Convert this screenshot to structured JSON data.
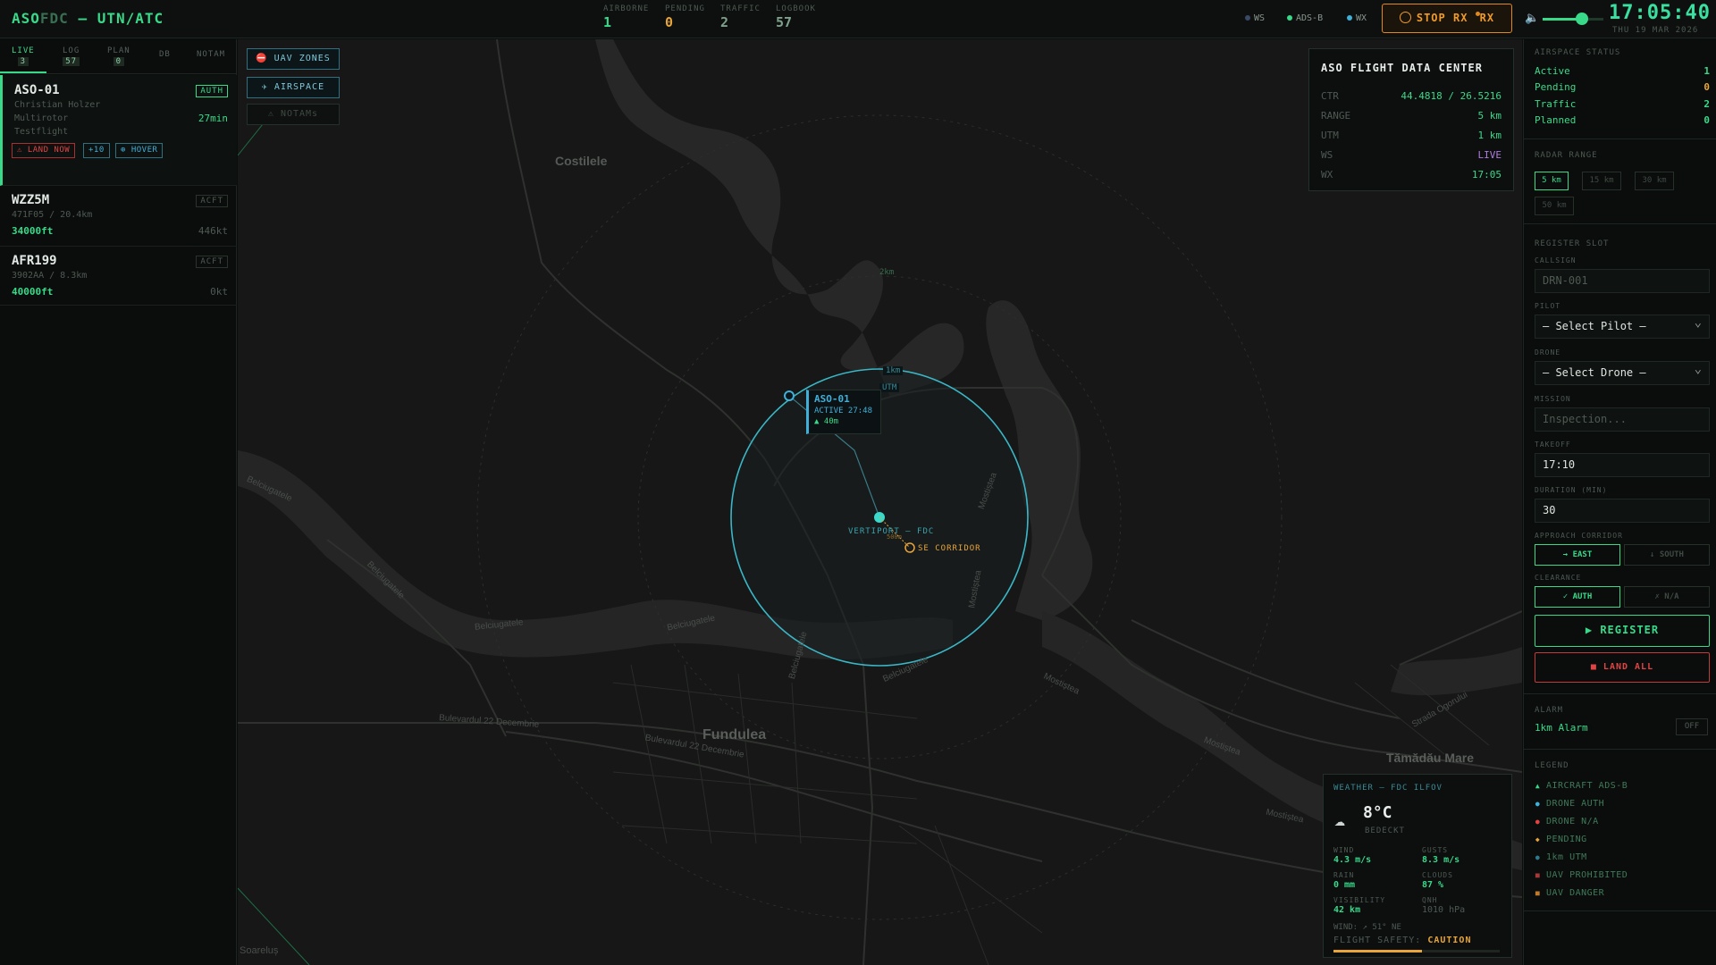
{
  "brand": {
    "aso": "ASO",
    "fdc": "FDC",
    "rest": " — UTN/ATC"
  },
  "stats": [
    {
      "label": "AIRBORNE",
      "value": "1",
      "color": "#39d98a"
    },
    {
      "label": "PENDING",
      "value": "0",
      "color": "#e8a53a"
    },
    {
      "label": "TRAFFIC",
      "value": "2",
      "color": "#7fa08c"
    },
    {
      "label": "LOGBOOK",
      "value": "57",
      "color": "#7fa08c"
    }
  ],
  "indicators": [
    {
      "label": "WS",
      "color": "#3a4a66"
    },
    {
      "label": "ADS-B",
      "color": "#39d98a"
    },
    {
      "label": "WX",
      "color": "#3fb0d9"
    }
  ],
  "stop_rx": {
    "label": "STOP RX",
    "suffix": "RX"
  },
  "clock": {
    "time": "17:05:40",
    "date": "THU 19 MAR 2026"
  },
  "volume": 0.65,
  "left_tabs": [
    {
      "label": "LIVE",
      "count": "3",
      "active": true
    },
    {
      "label": "LOG",
      "count": "57"
    },
    {
      "label": "PLAN",
      "count": "0"
    },
    {
      "label": "DB",
      "count": ""
    },
    {
      "label": "NOTAM",
      "count": ""
    }
  ],
  "flights": [
    {
      "callsign": "ASO-01",
      "badge": "AUTH",
      "pilot": "Christian Holzer",
      "type": "Multirotor",
      "mission": "Testflight",
      "time": "27min",
      "chips": [
        "⚠ LAND NOW",
        "+10",
        "⊕ HOVER"
      ]
    },
    {
      "callsign": "WZZ5M",
      "badge": "ACFT",
      "sub": "471F05 / 20.4km",
      "alt": "34000ft",
      "speed": "446kt"
    },
    {
      "callsign": "AFR199",
      "badge": "ACFT",
      "sub": "3902AA / 8.3km",
      "alt": "40000ft",
      "speed": "0kt"
    }
  ],
  "map": {
    "buttons": [
      "⛔ UAV ZONES",
      "✈ AIRSPACE",
      "⚠ NOTAMs"
    ],
    "places": [
      "Costilele",
      "Fundulea",
      "Tămădău Mare",
      "Soareluș"
    ],
    "streets": [
      "Belciugatele",
      "Belciugatele",
      "Belciugatele",
      "Belciugatele",
      "Belciugatele",
      "Bulevardul 22 Decembrie",
      "Bulevardul 22 Decembrie",
      "Mostiștea",
      "Mostiștea",
      "Mostiștea",
      "Mostiștea",
      "Mostiștea",
      "Strada Ogorului",
      "Belciugatele"
    ],
    "ring_labels": [
      "2km",
      "1km",
      "UTM"
    ],
    "drone": {
      "callsign": "ASO-01",
      "status": "ACTIVE 27:48",
      "alt": "▲ 40m"
    },
    "vertiport": "VERTIPORT — FDC",
    "corridor": "SE CORRIDOR",
    "corridor_dist": "500m"
  },
  "fdc": {
    "title": "ASO FLIGHT DATA CENTER",
    "rows": [
      {
        "k": "CTR",
        "v": "44.4818 / 26.5216",
        "c": "#39d98a"
      },
      {
        "k": "RANGE",
        "v": "5 km",
        "c": "#39d98a"
      },
      {
        "k": "UTM",
        "v": "1 km",
        "c": "#39d98a"
      },
      {
        "k": "WS",
        "v": "LIVE",
        "c": "#b07be0"
      },
      {
        "k": "WX",
        "v": "17:05",
        "c": "#39d98a"
      }
    ]
  },
  "weather": {
    "title": "WEATHER — FDC ILFOV",
    "temp": "8°C",
    "cond": "BEDECKT",
    "wind_l": "WIND",
    "wind_v": "4.3 m/s",
    "gust_l": "GUSTS",
    "gust_v": "8.3 m/s",
    "rain_l": "RAIN",
    "rain_v": "0 mm",
    "cloud_l": "CLOUDS",
    "cloud_v": "87 %",
    "vis_l": "VISIBILITY",
    "vis_v": "42 km",
    "qnh_l": "QNH",
    "qnh_v": "1010 hPa",
    "wind_dir": "WIND: ↗ 51° NE",
    "safety_l": "FLIGHT SAFETY:",
    "safety_v": "CAUTION",
    "safety_level": 0.53
  },
  "airspace": {
    "title": "AIRSPACE STATUS",
    "rows": [
      {
        "k": "Active",
        "v": "1",
        "c": "#39d98a"
      },
      {
        "k": "Pending",
        "v": "0",
        "c": "#e8a53a"
      },
      {
        "k": "Traffic",
        "v": "2",
        "c": "#39d98a"
      },
      {
        "k": "Planned",
        "v": "0",
        "c": "#39d98a"
      }
    ]
  },
  "radar": {
    "title": "RADAR RANGE",
    "options": [
      "5 km",
      "15 km",
      "30 km",
      "50 km"
    ],
    "selected": "5 km"
  },
  "register": {
    "title": "REGISTER SLOT",
    "callsign_l": "CALLSIGN",
    "callsign_ph": "DRN-001",
    "pilot_l": "PILOT",
    "pilot_v": "— Select Pilot —",
    "drone_l": "DRONE",
    "drone_v": "— Select Drone —",
    "mission_l": "MISSION",
    "mission_ph": "Inspection...",
    "takeoff_l": "TAKEOFF",
    "takeoff_v": "17:10",
    "duration_l": "DURATION (MIN)",
    "duration_v": "30",
    "corridor_l": "APPROACH CORRIDOR",
    "corridor_opts": [
      "→ EAST",
      "↓ SOUTH"
    ],
    "clear_l": "CLEARANCE",
    "clear_opts": [
      "✓ AUTH",
      "✗ N/A"
    ],
    "register_btn": "▶ REGISTER",
    "land_btn": "■ LAND ALL"
  },
  "alarm": {
    "title": "ALARM",
    "label": "1km Alarm",
    "state": "OFF"
  },
  "legend": {
    "title": "LEGEND",
    "items": [
      {
        "sym": "▲",
        "c": "#39d98a",
        "l": "AIRCRAFT ADS-B"
      },
      {
        "sym": "●",
        "c": "#3fb0d9",
        "l": "DRONE AUTH"
      },
      {
        "sym": "●",
        "c": "#e04444",
        "l": "DRONE N/A"
      },
      {
        "sym": "◆",
        "c": "#e8a53a",
        "l": "PENDING"
      },
      {
        "sym": "●",
        "c": "#2e7a8a",
        "l": "1km UTM"
      },
      {
        "sym": "■",
        "c": "#a83838",
        "l": "UAV PROHIBITED"
      },
      {
        "sym": "■",
        "c": "#c27a2a",
        "l": "UAV DANGER"
      }
    ]
  }
}
